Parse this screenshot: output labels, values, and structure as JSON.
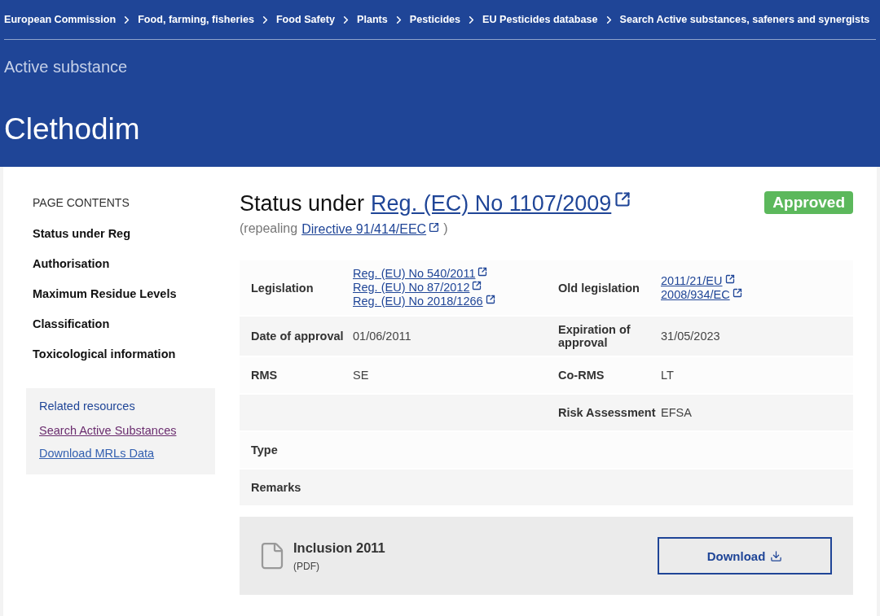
{
  "breadcrumb": [
    "European Commission",
    "Food, farming, fisheries",
    "Food Safety",
    "Plants",
    "Pesticides",
    "EU Pesticides database",
    "Search Active substances, safeners and synergists"
  ],
  "header": {
    "subtitle": "Active substance",
    "title": "Clethodim"
  },
  "page_contents": {
    "heading": "PAGE CONTENTS",
    "items": [
      "Status under Reg",
      "Authorisation",
      "Maximum Residue Levels",
      "Classification",
      "Toxicological information"
    ]
  },
  "related_resources": {
    "heading": "Related resources",
    "links": [
      {
        "label": "Search Active Substances",
        "visited": true
      },
      {
        "label": "Download MRLs Data",
        "visited": false
      }
    ]
  },
  "status": {
    "prefix": "Status under",
    "link": "Reg. (EC) No 1107/2009",
    "repealing_prefix": "(repealing",
    "repealing_link": "Directive 91/414/EEC",
    "repealing_suffix": ")",
    "badge": "Approved"
  },
  "rows": [
    {
      "cells": [
        {
          "kind": "label",
          "text": "Legislation"
        },
        {
          "kind": "links",
          "links": [
            "Reg. (EU) No 540/2011",
            "Reg. (EU) No 87/2012",
            "Reg. (EU) No 2018/1266"
          ]
        },
        {
          "kind": "label",
          "text": "Old legislation"
        },
        {
          "kind": "links",
          "links": [
            "2011/21/EU",
            "2008/934/EC"
          ]
        }
      ]
    },
    {
      "cells": [
        {
          "kind": "label",
          "text": "Date of approval"
        },
        {
          "kind": "text",
          "text": "01/06/2011"
        },
        {
          "kind": "label",
          "text": "Expiration of approval"
        },
        {
          "kind": "text",
          "text": "31/05/2023"
        }
      ]
    },
    {
      "cells": [
        {
          "kind": "label",
          "text": "RMS"
        },
        {
          "kind": "text",
          "text": "SE"
        },
        {
          "kind": "label",
          "text": "Co-RMS"
        },
        {
          "kind": "text",
          "text": "LT"
        }
      ]
    },
    {
      "cells": [
        {
          "kind": "empty"
        },
        {
          "kind": "empty"
        },
        {
          "kind": "label",
          "text": "Risk Assessment"
        },
        {
          "kind": "text",
          "text": "EFSA"
        }
      ]
    },
    {
      "cells": [
        {
          "kind": "label",
          "text": "Type"
        },
        {
          "kind": "empty"
        },
        {
          "kind": "empty"
        },
        {
          "kind": "empty"
        }
      ]
    },
    {
      "cells": [
        {
          "kind": "label",
          "text": "Remarks"
        },
        {
          "kind": "empty"
        },
        {
          "kind": "empty"
        },
        {
          "kind": "empty"
        }
      ]
    }
  ],
  "document": {
    "title": "Inclusion 2011",
    "format": "(PDF)",
    "button": "Download"
  }
}
